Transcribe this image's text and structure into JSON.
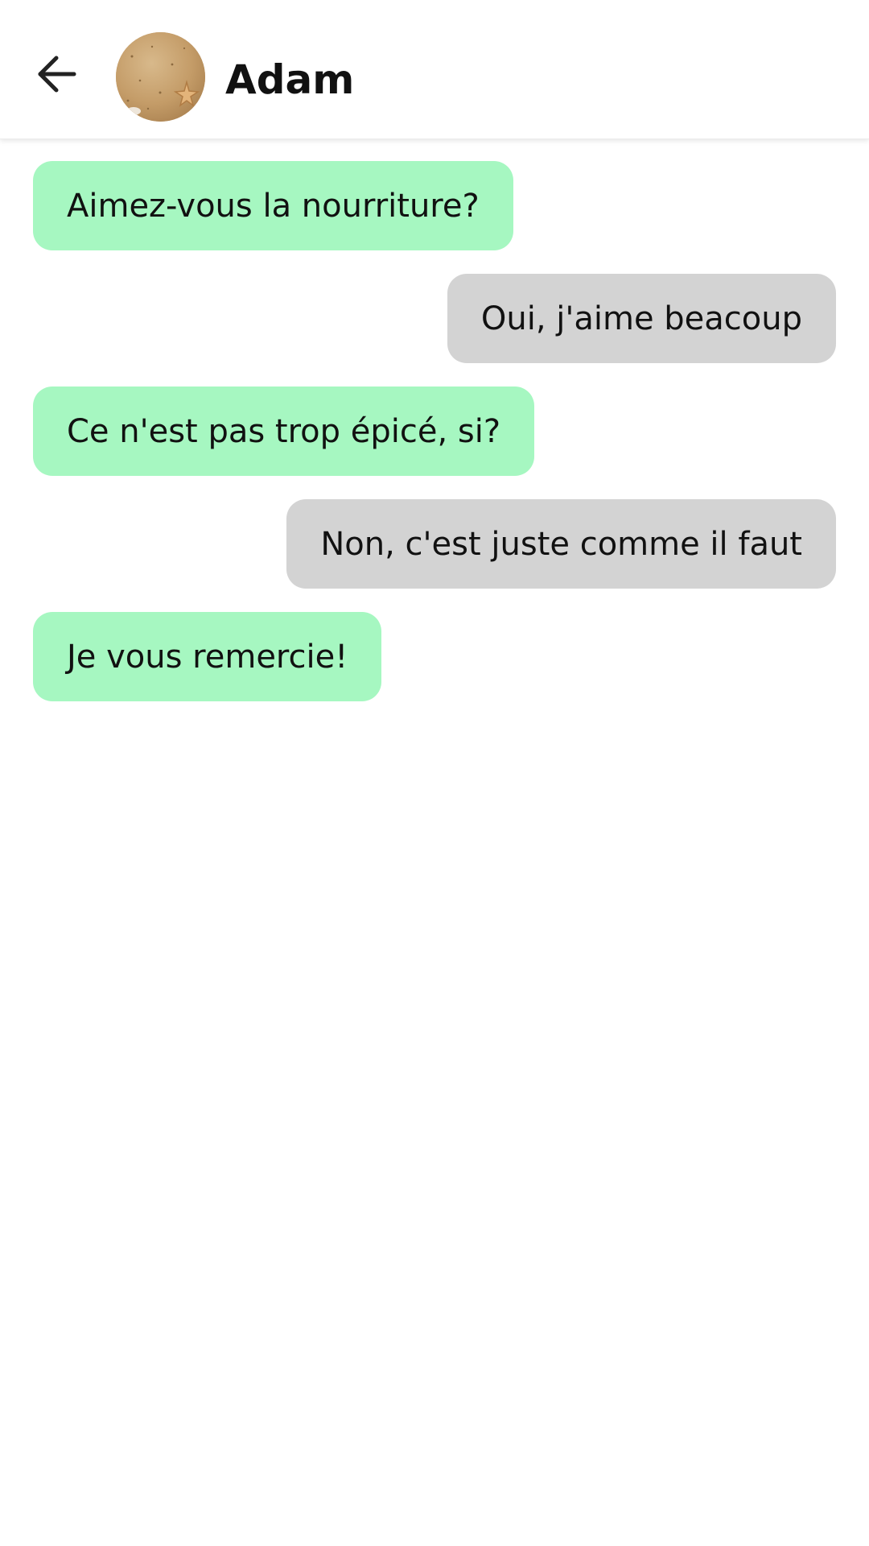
{
  "header": {
    "contact_name": "Adam"
  },
  "colors": {
    "received_bubble": "#a6f7c1",
    "sent_bubble": "#d3d3d3",
    "background": "#ffffff",
    "text": "#111111"
  },
  "icons": {
    "back": "arrow-left-icon",
    "avatar": "sand-starfish-avatar"
  },
  "messages": [
    {
      "direction": "received",
      "text": "Aimez-vous la nourriture?"
    },
    {
      "direction": "sent",
      "text": "Oui, j'aime beacoup"
    },
    {
      "direction": "received",
      "text": "Ce n'est pas trop épicé, si?"
    },
    {
      "direction": "sent",
      "text": "Non, c'est juste comme il faut"
    },
    {
      "direction": "received",
      "text": "Je vous remercie!"
    }
  ]
}
